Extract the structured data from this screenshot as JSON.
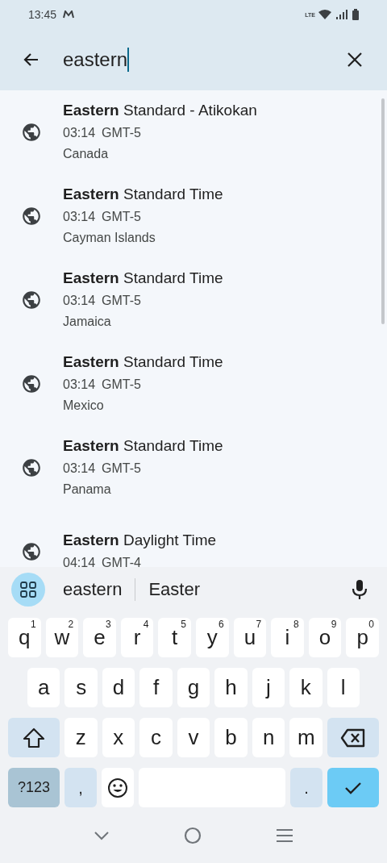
{
  "status_bar": {
    "time": "13:45",
    "network": "LTE"
  },
  "search": {
    "value": "eastern"
  },
  "results": [
    {
      "title": "**Eastern** Standard - Atikokan",
      "time": "03:14",
      "offset": "GMT-5",
      "region": "Canada"
    },
    {
      "title": "**Eastern** Standard Time",
      "time": "03:14",
      "offset": "GMT-5",
      "region": "Cayman Islands"
    },
    {
      "title": "**Eastern** Standard Time",
      "time": "03:14",
      "offset": "GMT-5",
      "region": "Jamaica"
    },
    {
      "title": "**Eastern** Standard Time",
      "time": "03:14",
      "offset": "GMT-5",
      "region": "Mexico"
    },
    {
      "title": "**Eastern** Standard Time",
      "time": "03:14",
      "offset": "GMT-5",
      "region": "Panama"
    },
    {
      "title": "**Eastern** Daylight Time",
      "time": "04:14",
      "offset": "GMT-4"
    }
  ],
  "suggestions": [
    "eastern",
    "Easter"
  ],
  "keyboard": [
    [
      {
        "kind": "letter",
        "label": "q",
        "hint": "1"
      },
      {
        "kind": "letter",
        "label": "w",
        "hint": "2"
      },
      {
        "kind": "letter",
        "label": "e",
        "hint": "3"
      },
      {
        "kind": "letter",
        "label": "r",
        "hint": "4"
      },
      {
        "kind": "letter",
        "label": "t",
        "hint": "5"
      },
      {
        "kind": "letter",
        "label": "y",
        "hint": "6"
      },
      {
        "kind": "letter",
        "label": "u",
        "hint": "7"
      },
      {
        "kind": "letter",
        "label": "i",
        "hint": "8"
      },
      {
        "kind": "letter",
        "label": "o",
        "hint": "9"
      },
      {
        "kind": "letter",
        "label": "p",
        "hint": "0"
      }
    ],
    [
      {
        "kind": "letter",
        "label": "a"
      },
      {
        "kind": "letter",
        "label": "s"
      },
      {
        "kind": "letter",
        "label": "d"
      },
      {
        "kind": "letter",
        "label": "f"
      },
      {
        "kind": "letter",
        "label": "g"
      },
      {
        "kind": "letter",
        "label": "h"
      },
      {
        "kind": "letter",
        "label": "j"
      },
      {
        "kind": "letter",
        "label": "k"
      },
      {
        "kind": "letter",
        "label": "l"
      }
    ],
    [
      {
        "kind": "shift"
      },
      {
        "kind": "letter",
        "label": "z"
      },
      {
        "kind": "letter",
        "label": "x"
      },
      {
        "kind": "letter",
        "label": "c"
      },
      {
        "kind": "letter",
        "label": "v"
      },
      {
        "kind": "letter",
        "label": "b"
      },
      {
        "kind": "letter",
        "label": "n"
      },
      {
        "kind": "letter",
        "label": "m"
      },
      {
        "kind": "backspace"
      }
    ],
    [
      {
        "kind": "symbols",
        "label": "?123"
      },
      {
        "kind": "punct",
        "label": ","
      },
      {
        "kind": "emoji"
      },
      {
        "kind": "space"
      },
      {
        "kind": "punct",
        "label": "."
      },
      {
        "kind": "enter"
      }
    ]
  ]
}
